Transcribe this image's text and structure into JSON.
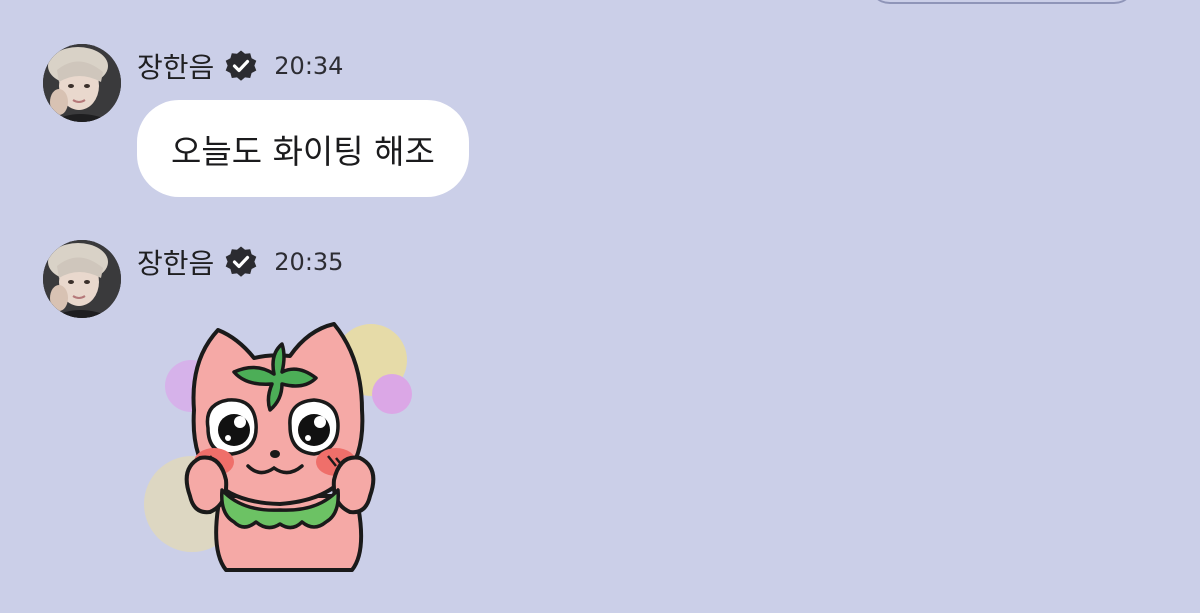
{
  "chat": {
    "messages": [
      {
        "sender": "장한음",
        "time": "20:34",
        "text": "오늘도 화이팅 해조",
        "verified_icon": "verified-badge-icon",
        "avatar_icon": "profile-photo"
      },
      {
        "sender": "장한음",
        "time": "20:35",
        "sticker_icon": "pink-cat-sticker",
        "verified_icon": "verified-badge-icon",
        "avatar_icon": "profile-photo"
      }
    ]
  },
  "colors": {
    "background": "#cbcfe8",
    "bubble": "#ffffff",
    "text": "#1d1d1f",
    "badge": "#2b2b30",
    "sticker_pink": "#f5a9a6",
    "sticker_green": "#4cae57",
    "sticker_blush": "#ef6f6a"
  }
}
